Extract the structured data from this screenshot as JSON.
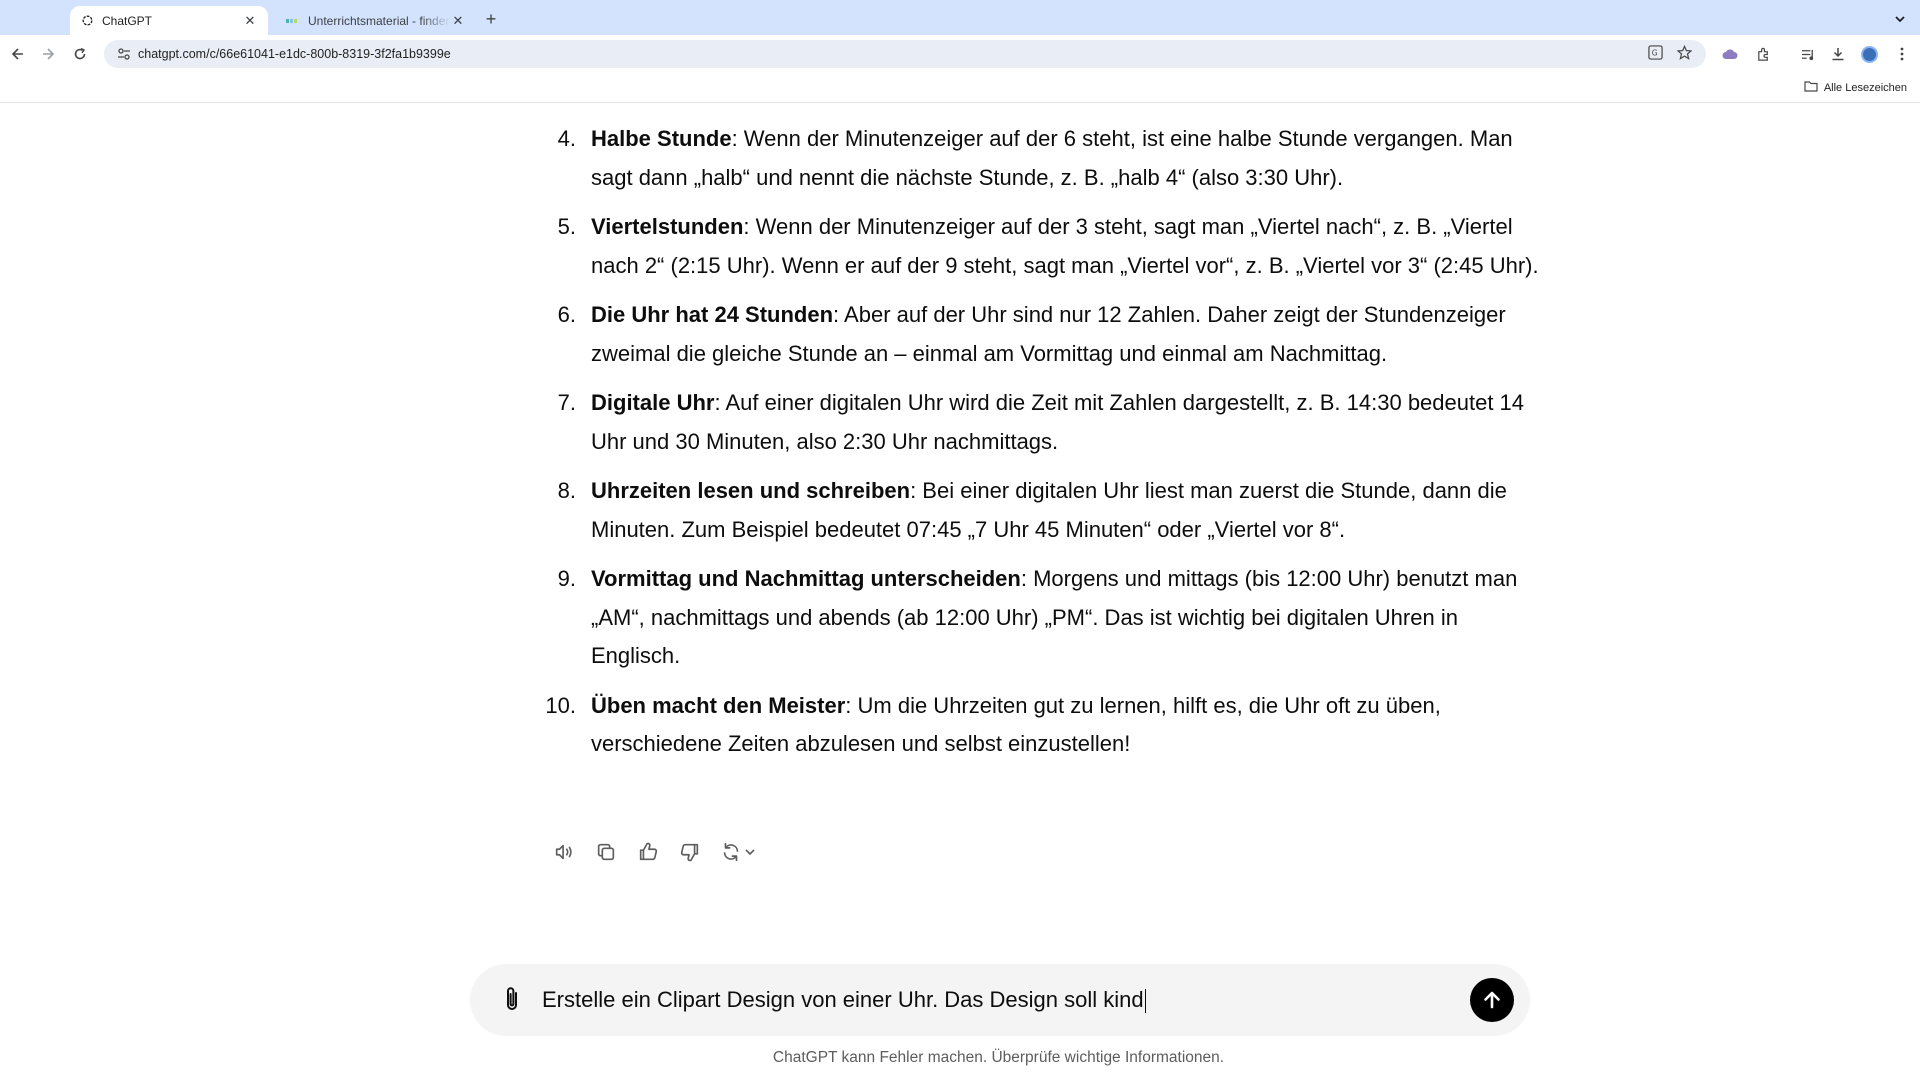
{
  "browser": {
    "tabs": [
      {
        "title": "ChatGPT",
        "active": true
      },
      {
        "title": "Unterrichtsmaterial - finden & ",
        "active": false
      }
    ],
    "url": "chatgpt.com/c/66e61041-e1dc-800b-8319-3f2fa1b9399e",
    "bookmarks_label": "Alle Lesezeichen"
  },
  "chat": {
    "items": [
      {
        "num": "4.",
        "bold": "Halbe Stunde",
        "text": ": Wenn der Minutenzeiger auf der 6 steht, ist eine halbe Stunde vergangen. Man sagt dann „halb“ und nennt die nächste Stunde, z. B. „halb 4“ (also 3:30 Uhr)."
      },
      {
        "num": "5.",
        "bold": "Viertelstunden",
        "text": ": Wenn der Minutenzeiger auf der 3 steht, sagt man „Viertel nach“, z. B. „Viertel nach 2“ (2:15 Uhr). Wenn er auf der 9 steht, sagt man „Viertel vor“, z. B. „Viertel vor 3“ (2:45 Uhr)."
      },
      {
        "num": "6.",
        "bold": "Die Uhr hat 24 Stunden",
        "text": ": Aber auf der Uhr sind nur 12 Zahlen. Daher zeigt der Stundenzeiger zweimal die gleiche Stunde an – einmal am Vormittag und einmal am Nachmittag."
      },
      {
        "num": "7.",
        "bold": "Digitale Uhr",
        "text": ": Auf einer digitalen Uhr wird die Zeit mit Zahlen dargestellt, z. B. 14:30 bedeutet 14 Uhr und 30 Minuten, also 2:30 Uhr nachmittags."
      },
      {
        "num": "8.",
        "bold": "Uhrzeiten lesen und schreiben",
        "text": ": Bei einer digitalen Uhr liest man zuerst die Stunde, dann die Minuten. Zum Beispiel bedeutet 07:45 „7 Uhr 45 Minuten“ oder „Viertel vor 8“."
      },
      {
        "num": "9.",
        "bold": "Vormittag und Nachmittag unterscheiden",
        "text": ": Morgens und mittags (bis 12:00 Uhr) benutzt man „AM“, nachmittags und abends (ab 12:00 Uhr) „PM“. Das ist wichtig bei digitalen Uhren in Englisch."
      },
      {
        "num": "10.",
        "bold": "Üben macht den Meister",
        "text": ": Um die Uhrzeiten gut zu lernen, hilft es, die Uhr oft zu üben, verschiedene Zeiten abzulesen und selbst einzustellen!"
      }
    ]
  },
  "composer": {
    "value": "Erstelle ein Clipart Design von einer Uhr. Das Design soll kind"
  },
  "disclaimer": "ChatGPT kann Fehler machen. Überprüfe wichtige Informationen."
}
